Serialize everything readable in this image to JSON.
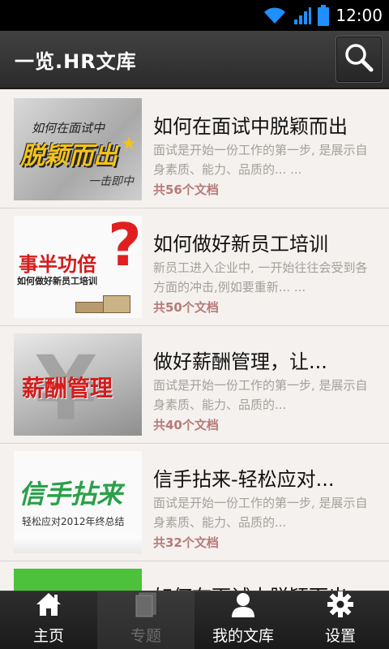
{
  "status_bar": {
    "time": "12:00"
  },
  "header": {
    "title": "一览.HR文库",
    "search_icon": "search-icon"
  },
  "docs": [
    {
      "title": "如何在面试中脱颖而出",
      "desc": "面试是开始一份工作的第一步, 是展示自身素质、能力、品质的... ...",
      "count": "共56个文档",
      "thumb": {
        "top_text": "如何在面试中",
        "big_text": "脱颖而出",
        "bottom_text": "一击即中"
      }
    },
    {
      "title": "如何做好新员工培训",
      "desc": "新员工进入企业中, 一开始往往会受到各方面的冲击,例如要重新... ...",
      "count": "共50个文档",
      "thumb": {
        "big_text": "事半功倍",
        "bottom_text": "如何做好新员工培训"
      }
    },
    {
      "title": " 做好薪酬管理，让...",
      "desc": "面试是开始一份工作的第一步, 是展示自身素质、能力、品质的...",
      "count": "共40个文档",
      "thumb": {
        "big_text": "薪酬管理"
      }
    },
    {
      "title": "信手拈来-轻松应对...",
      "desc": "面试是开始一份工作的第一步, 是展示自身素质、能力、品质的...",
      "count": "共32个文档",
      "thumb": {
        "big_text": "信手拈来",
        "bottom_text": "轻松应对2012年终总结"
      }
    },
    {
      "title": "如何在面试中脱颖而出",
      "desc": "",
      "count": "",
      "thumb": {}
    }
  ],
  "nav": [
    {
      "label": "主页",
      "icon": "home-icon",
      "active": false
    },
    {
      "label": "专题",
      "icon": "topics-icon",
      "active": true
    },
    {
      "label": "我的文库",
      "icon": "user-icon",
      "active": false
    },
    {
      "label": "设置",
      "icon": "gear-icon",
      "active": false
    }
  ]
}
